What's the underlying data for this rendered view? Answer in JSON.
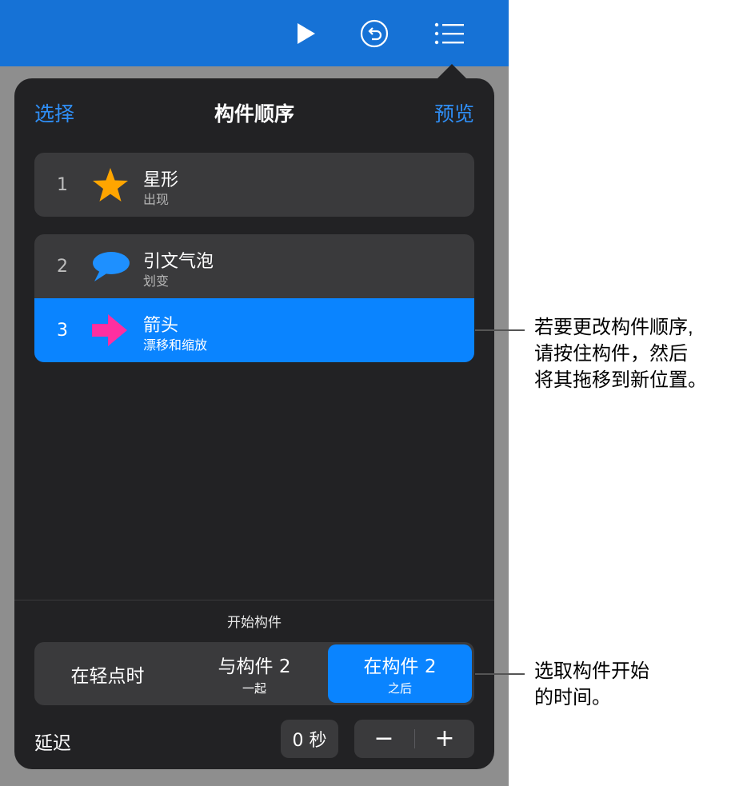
{
  "popover": {
    "nav_left": "选择",
    "title": "构件顺序",
    "nav_right": "预览"
  },
  "builds": [
    {
      "number": "1",
      "title": "星形",
      "effect": "出现",
      "icon": "star-icon",
      "color": "#ffa500"
    },
    {
      "number": "2",
      "title": "引文气泡",
      "effect": "划变",
      "icon": "speech-bubble-icon",
      "color": "#1e90ff"
    },
    {
      "number": "3",
      "title": "箭头",
      "effect": "漂移和缩放",
      "icon": "arrow-icon",
      "color": "#ff2fa0",
      "selected": true
    }
  ],
  "start": {
    "label": "开始构件",
    "options": [
      {
        "main": "在轻点时",
        "sub": ""
      },
      {
        "main": "与构件 2",
        "sub": "一起"
      },
      {
        "main": "在构件 2",
        "sub": "之后",
        "selected": true
      }
    ]
  },
  "delay": {
    "label": "延迟",
    "value": "0 秒",
    "minus": "−",
    "plus": "+"
  },
  "callouts": {
    "reorder": [
      "若要更改构件顺序,",
      "请按住构件，然后",
      "将其拖移到新位置。"
    ],
    "start": [
      "选取构件开始",
      "的时间。"
    ]
  },
  "colors": {
    "toolbar": "#1672d6",
    "accent": "#0a84ff",
    "popover_bg": "#222224"
  }
}
